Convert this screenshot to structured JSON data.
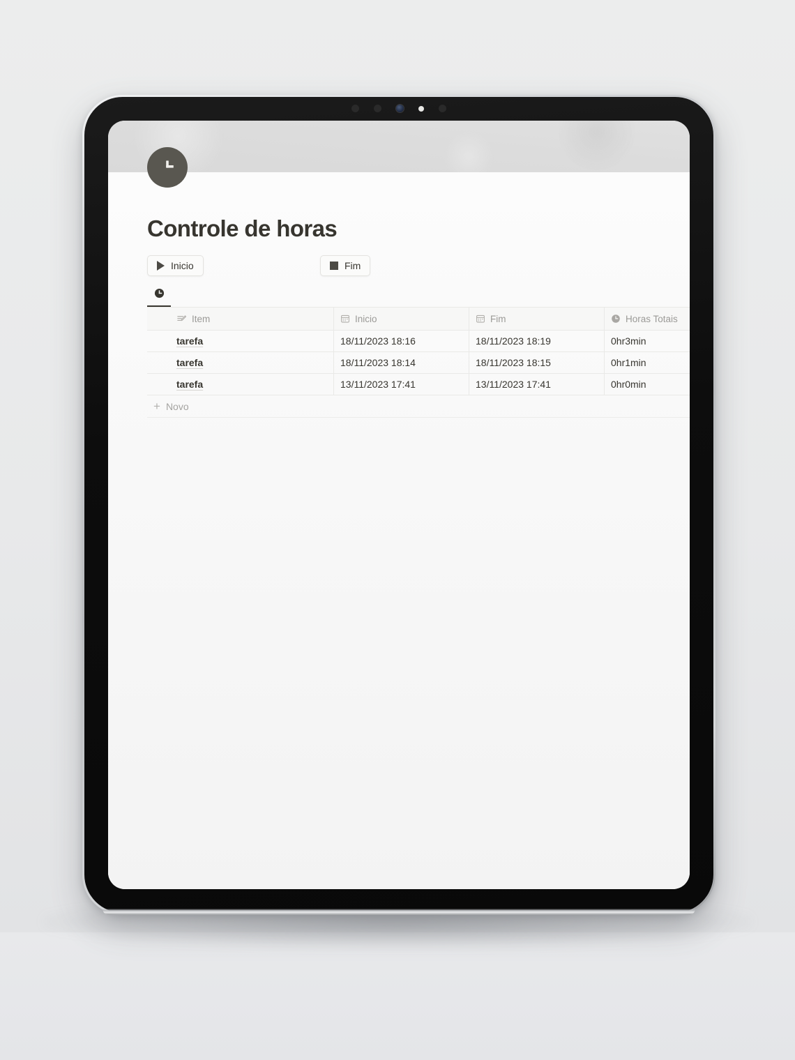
{
  "device": {
    "type": "tablet-mockup",
    "camera_dots": [
      "sensor",
      "sensor",
      "lens",
      "led",
      "sensor"
    ]
  },
  "page": {
    "icon": "clock-icon",
    "icon_color": "#595750",
    "cover_color": "#dcdcdc",
    "title": "Controle de horas"
  },
  "toolbar": {
    "start_label": "Inicio",
    "start_icon": "play-icon",
    "stop_label": "Fim",
    "stop_icon": "stop-icon"
  },
  "view_tabs": [
    {
      "icon": "clock-icon",
      "label": "",
      "active": true
    }
  ],
  "table": {
    "columns": [
      {
        "label": "Item",
        "icon": "text-edit-icon"
      },
      {
        "label": "Inicio",
        "icon": "calendar-icon"
      },
      {
        "label": "Fim",
        "icon": "calendar-icon"
      },
      {
        "label": "Horas Totais",
        "icon": "clock-icon"
      }
    ],
    "rows": [
      {
        "item": "tarefa",
        "inicio": "18/11/2023 18:16",
        "fim": "18/11/2023 18:19",
        "total": "0hr3min"
      },
      {
        "item": "tarefa",
        "inicio": "18/11/2023 18:14",
        "fim": "18/11/2023 18:15",
        "total": "0hr1min"
      },
      {
        "item": "tarefa",
        "inicio": "13/11/2023 17:41",
        "fim": "13/11/2023 17:41",
        "total": "0hr0min"
      }
    ],
    "new_row_label": "Novo",
    "new_row_icon": "plus-icon"
  },
  "colors": {
    "text_primary": "#37352f",
    "text_muted": "#9b9a97",
    "border": "#e9e9e7",
    "page_bg": "#fafafa",
    "header_bg": "#f7f7f6"
  }
}
